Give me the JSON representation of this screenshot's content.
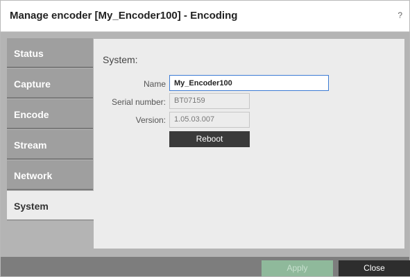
{
  "window": {
    "title": "Manage encoder [My_Encoder100] - Encoding",
    "help_label": "?"
  },
  "tabs": [
    {
      "label": "Status",
      "active": false
    },
    {
      "label": "Capture",
      "active": false
    },
    {
      "label": "Encode",
      "active": false
    },
    {
      "label": "Stream",
      "active": false
    },
    {
      "label": "Network",
      "active": false
    },
    {
      "label": "System",
      "active": true
    }
  ],
  "system": {
    "section_title": "System:",
    "name_label": "Name",
    "name_value": "My_Encoder100",
    "serial_label": "Serial number:",
    "serial_value": "BT07159",
    "version_label": "Version:",
    "version_value": "1.05.03.007",
    "reboot_label": "Reboot"
  },
  "footer": {
    "apply_label": "Apply",
    "close_label": "Close"
  },
  "colors": {
    "accent_focus": "#3c7bd4",
    "apply_disabled": "#8fb99b",
    "dark_button": "#2d2d2d"
  }
}
